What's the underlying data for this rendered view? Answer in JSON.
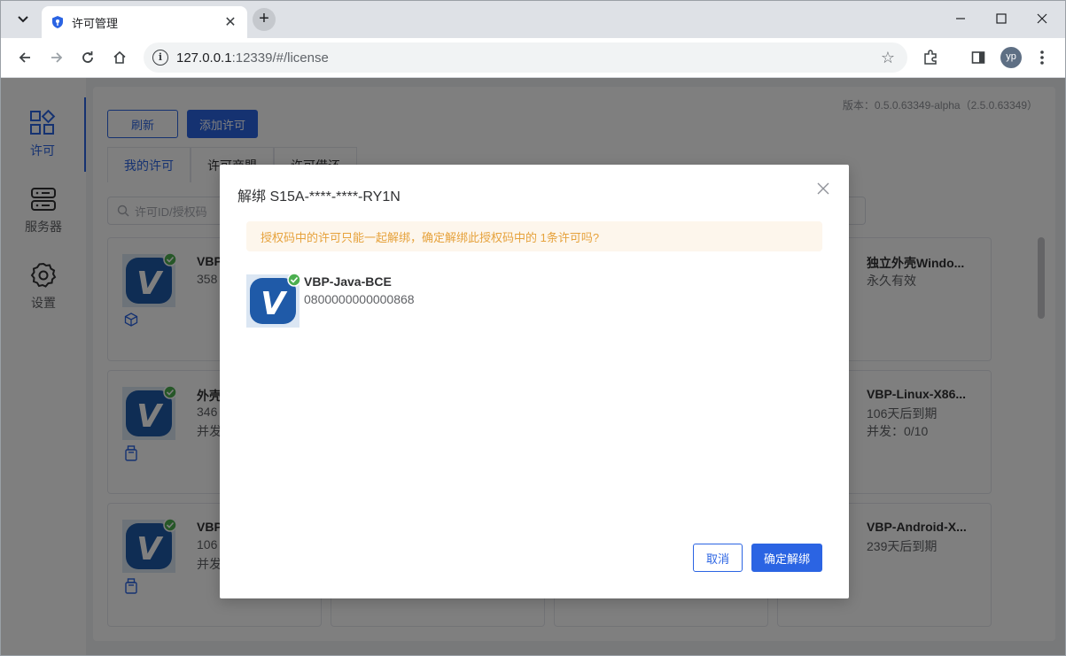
{
  "browser": {
    "tab_title": "许可管理",
    "url_host": "127.0.0.1",
    "url_rest": ":12339/#/license",
    "profile_initials": "yp"
  },
  "sidebar": {
    "items": [
      {
        "label": "许可",
        "icon": "apps-grid-icon",
        "active": true
      },
      {
        "label": "服务器",
        "icon": "server-icon",
        "active": false
      },
      {
        "label": "设置",
        "icon": "gear-icon",
        "active": false
      }
    ]
  },
  "main": {
    "version": "版本：0.5.0.63349-alpha（2.5.0.63349）",
    "refresh_label": "刷新",
    "add_license_label": "添加许可",
    "tabs": [
      {
        "label": "我的许可",
        "active": true
      },
      {
        "label": "许可商盟",
        "active": false
      },
      {
        "label": "许可借还",
        "active": false
      }
    ],
    "search_placeholder": "许可ID/授权码",
    "cards": [
      {
        "name": "VBP",
        "line1": "358",
        "line2": "",
        "kind_icon": "cube-icon"
      },
      {
        "name": "外壳",
        "line1": "346",
        "line2": "并发",
        "kind_icon": "usb-dongle-icon"
      },
      {
        "name": "VBP",
        "line1": "106",
        "line2": "并发",
        "kind_icon": "usb-dongle-icon"
      },
      {
        "name": "独立外壳Windo...",
        "line1": "永久有效",
        "line2": ""
      },
      {
        "name": "VBP-Linux-X86...",
        "line1": "106天后到期",
        "line2": "并发：0/10"
      },
      {
        "name": "VBP-Android-X...",
        "line1": "239天后到期",
        "line2": ""
      }
    ]
  },
  "dialog": {
    "title": "解绑 S15A-****-****-RY1N",
    "warning": "授权码中的许可只能一起解绑，确定解绑此授权码中的 1条许可吗?",
    "license_name": "VBP-Java-BCE",
    "license_id": "0800000000000868",
    "cancel_label": "取消",
    "confirm_label": "确定解绑"
  },
  "colors": {
    "primary": "#2b64e3",
    "warning_text": "#e6a23c",
    "warning_bg": "#fdf6ec",
    "success": "#4caf50"
  }
}
